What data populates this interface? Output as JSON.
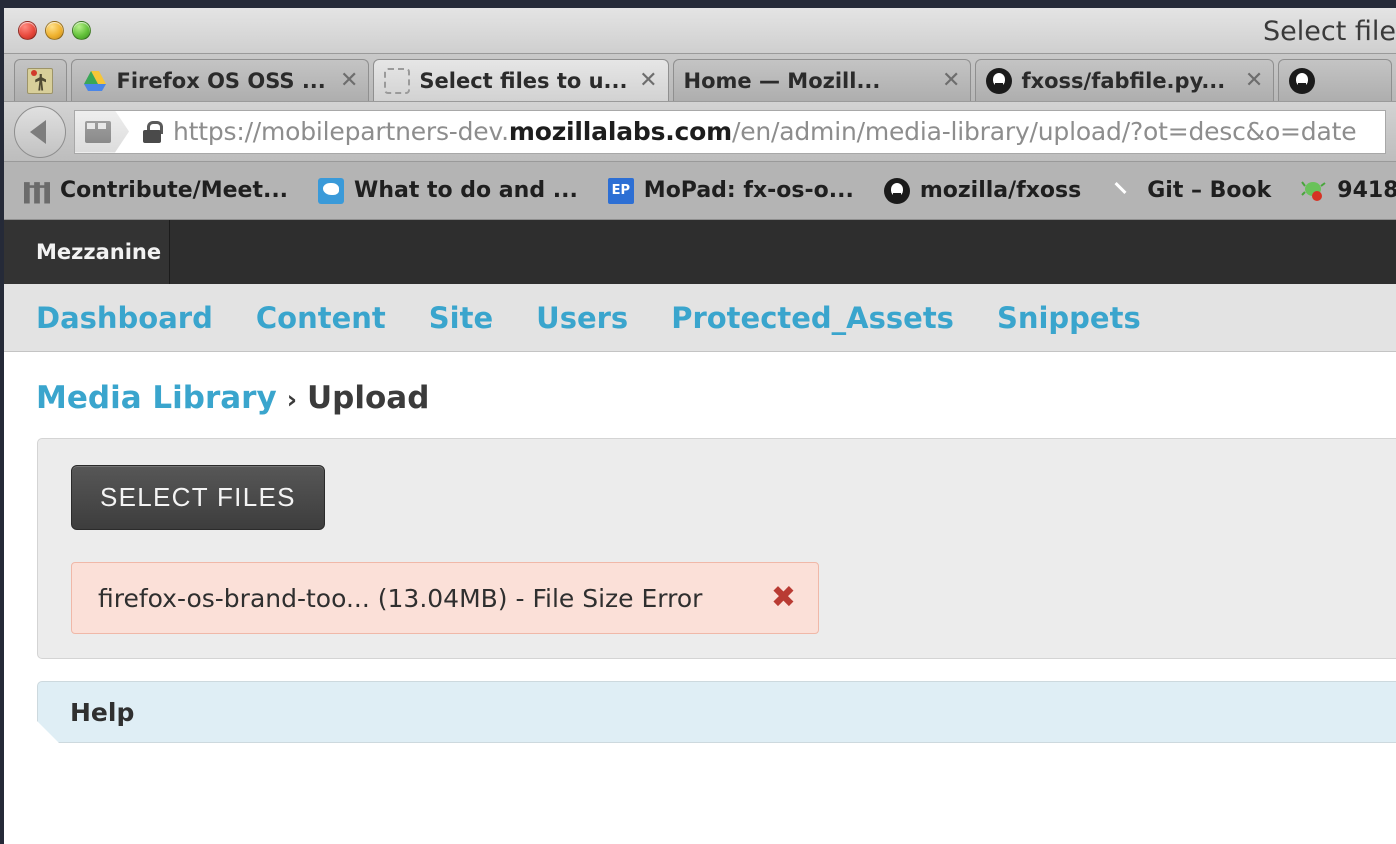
{
  "window": {
    "title": "Select file",
    "traffic_lights": [
      "close",
      "minimize",
      "zoom"
    ]
  },
  "tabs": [
    {
      "label": "",
      "icon": "pinboard-favicon",
      "closable": false,
      "active": false,
      "pinned": true
    },
    {
      "label": "Firefox OS OSS ...",
      "icon": "google-drive-favicon",
      "close": "✕",
      "active": false
    },
    {
      "label": "Select files to u...",
      "icon": "placeholder-favicon",
      "close": "✕",
      "active": true
    },
    {
      "label": "Home — Mozill...",
      "icon": "none",
      "close": "✕",
      "active": false
    },
    {
      "label": "fxoss/fabfile.py...",
      "icon": "github-favicon",
      "close": "✕",
      "active": false
    },
    {
      "label": "",
      "icon": "github-favicon",
      "close": "",
      "active": false
    }
  ],
  "navbar": {
    "back_label": "Back",
    "url_prefix": "https://mobilepartners-dev.",
    "url_host": "mozillalabs.com",
    "url_path": "/en/admin/media-library/upload/?ot=desc&o=date",
    "lock": "secure-connection"
  },
  "bookmarks": [
    {
      "label": "Contribute/Meet...",
      "icon": "mozilla-m-icon"
    },
    {
      "label": "What to do and ...",
      "icon": "speech-bubble-icon"
    },
    {
      "label": "MoPad: fx-os-o...",
      "icon": "etherpad-icon",
      "icon_text": "EP"
    },
    {
      "label": "mozilla/fxoss",
      "icon": "github-icon"
    },
    {
      "label": "Git – Book",
      "icon": "git-icon"
    },
    {
      "label": "9418",
      "icon": "bug-icon"
    }
  ],
  "admin": {
    "brand": "Mezzanine",
    "nav": [
      {
        "label": "Dashboard"
      },
      {
        "label": "Content"
      },
      {
        "label": "Site"
      },
      {
        "label": "Users"
      },
      {
        "label": "Protected_Assets"
      },
      {
        "label": "Snippets"
      }
    ],
    "breadcrumb": {
      "parent": "Media Library",
      "separator": "›",
      "current": "Upload"
    },
    "upload": {
      "select_files_label": "SELECT FILES",
      "files": [
        {
          "name": "firefox-os-brand-too...",
          "size": "(13.04MB)",
          "status": "- File Size Error",
          "display": "firefox-os-brand-too... (13.04MB) - File Size Error",
          "remove": "✖"
        }
      ]
    },
    "help": {
      "title": "Help"
    }
  },
  "colors": {
    "accent_link": "#3aa5cd",
    "admin_header_bg": "#2e2e2e",
    "admin_nav_bg": "#e3e3e3",
    "panel_bg": "#ececec",
    "help_bg": "#dfeef5",
    "error_bg": "#fbe0d8",
    "error_border": "#f0b8a8",
    "error_x": "#b93b33",
    "button_bg": "#4a4a4a"
  }
}
